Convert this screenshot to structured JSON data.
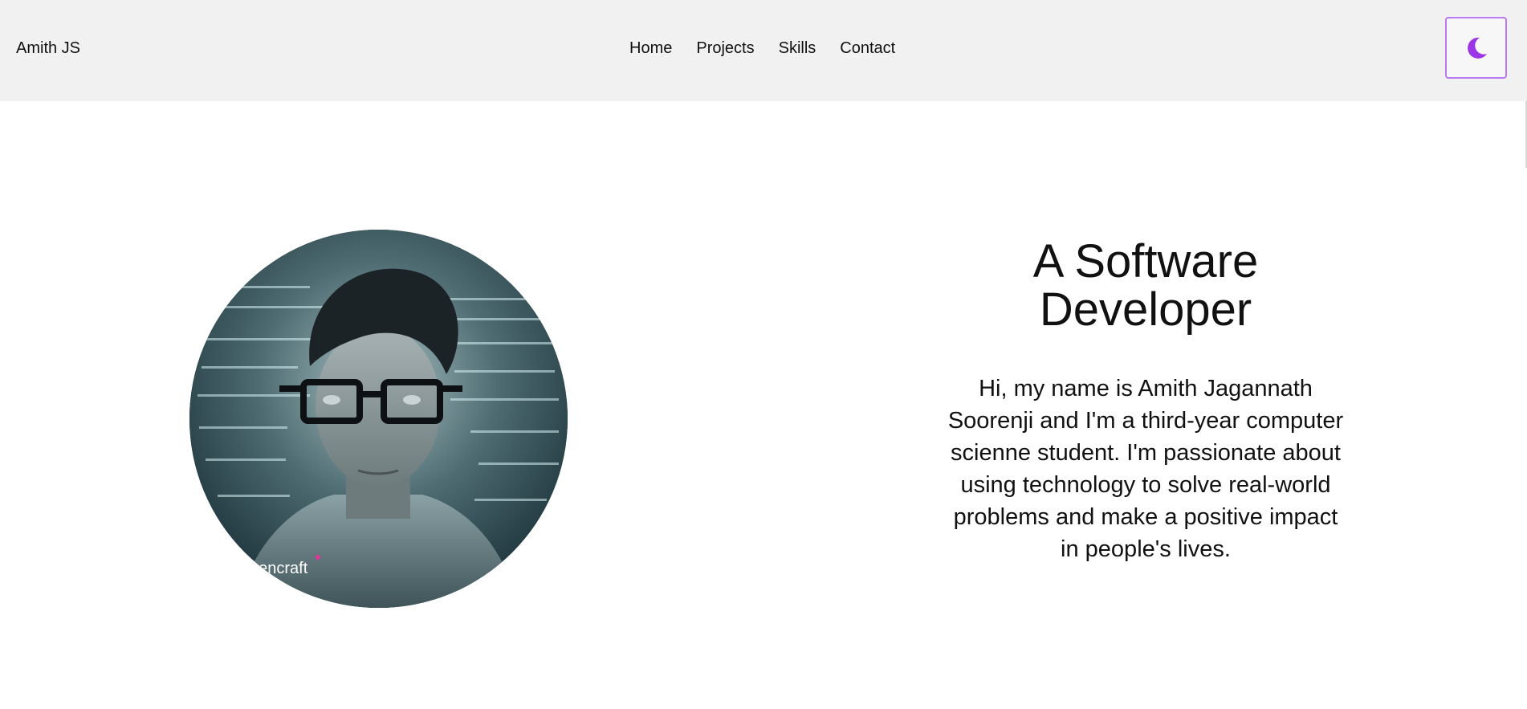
{
  "header": {
    "brand": "Amith JS",
    "nav": [
      {
        "label": "Home"
      },
      {
        "label": "Projects"
      },
      {
        "label": "Skills"
      },
      {
        "label": "Contact"
      }
    ],
    "theme_toggle_icon": "moon-icon",
    "accent_color": "#9b35e6"
  },
  "hero": {
    "title": "A Software Developer",
    "description": "Hi, my name is Amith Jagannath Soorenji and I'm a third-year computer scienne student. I'm passionate about using technology to solve real-world problems and make a positive impact in people's lives.",
    "image_watermark": "gencraft"
  }
}
